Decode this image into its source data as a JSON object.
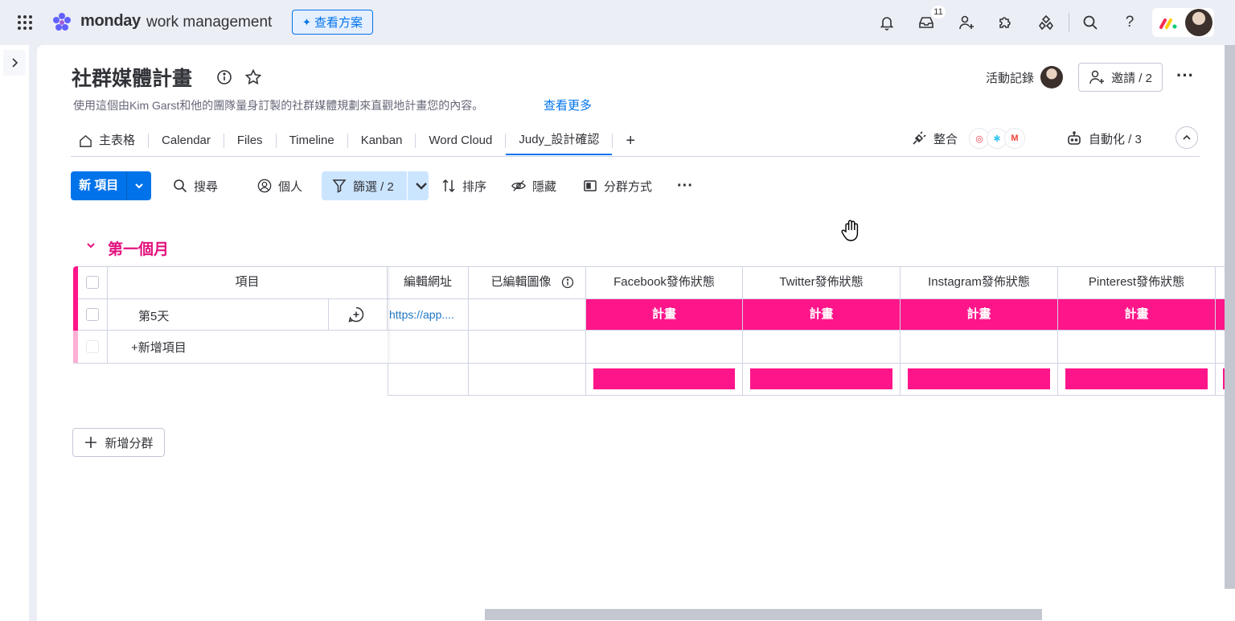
{
  "topbar": {
    "brand_word": "monday",
    "brand_sub": "work management",
    "see_plans": "查看方案",
    "inbox_count": "11",
    "icons": [
      "apps-grid-icon",
      "bell-icon",
      "inbox-icon",
      "invite-user-icon",
      "puzzle-icon",
      "apps-marketplace-icon",
      "search-icon",
      "help-icon"
    ]
  },
  "board": {
    "title": "社群媒體計畫",
    "description": "使用這個由Kim Garst和他的團隊量身訂製的社群媒體規劃來直觀地計畫您的內容。",
    "see_more": "查看更多",
    "activity_label": "活動記錄",
    "invite_label": "邀請 / 2"
  },
  "tabs": [
    {
      "label": "主表格"
    },
    {
      "label": "Calendar"
    },
    {
      "label": "Files"
    },
    {
      "label": "Timeline"
    },
    {
      "label": "Kanban"
    },
    {
      "label": "Word Cloud"
    },
    {
      "label": "Judy_設計確認",
      "active": true
    }
  ],
  "integrate_label": "整合",
  "automate_label": "自動化 / 3",
  "toolbar": {
    "new_item": "新 項目",
    "search": "搜尋",
    "person": "個人",
    "filter": "篩選 / 2",
    "sort": "排序",
    "hide": "隱藏",
    "group_by": "分群方式",
    "more": "···"
  },
  "group": {
    "title": "第一個月",
    "color": "#e2137e",
    "status_color": "#ff158a",
    "columns": [
      "項目",
      "編輯網址",
      "已編輯圖像",
      "Facebook發佈狀態",
      "Twitter發佈狀態",
      "Instagram發佈狀態",
      "Pinterest發佈狀態"
    ],
    "rows": [
      {
        "item": "第5天",
        "url": "https://app....",
        "image": "",
        "statuses": [
          "計畫",
          "計畫",
          "計畫",
          "計畫"
        ]
      }
    ],
    "add_item": "+新增項目"
  },
  "add_group": "新增分群"
}
